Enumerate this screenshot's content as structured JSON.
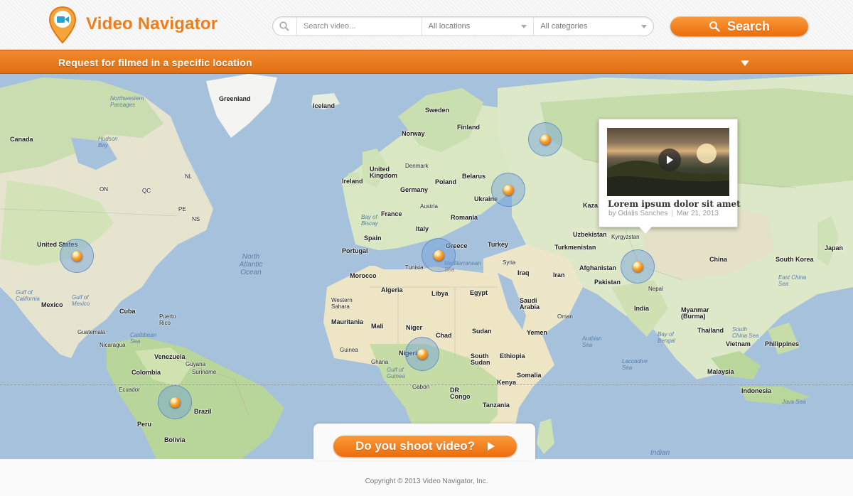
{
  "brand": {
    "name": "Video Navigator",
    "accent": "#f07d1a"
  },
  "search": {
    "placeholder": "Search video...",
    "location_value": "All locations",
    "category_value": "All categories",
    "button_label": "Search",
    "icon": "search-icon"
  },
  "request_bar": {
    "label": "Request for filmed in a specific location",
    "toggle_icon": "chevron-down-icon"
  },
  "map": {
    "labels": {
      "greenland": "Greenland",
      "iceland": "Iceland",
      "sweden": "Sweden",
      "finland": "Finland",
      "norway": "Norway",
      "denmark": "Denmark",
      "uk": "United Kingdom",
      "ireland": "Ireland",
      "belarus": "Belarus",
      "poland": "Poland",
      "germany": "Germany",
      "austria": "Austria",
      "ukraine": "Ukraine",
      "france": "France",
      "romania": "Romania",
      "bay_biscay": "Bay of Biscay",
      "spain": "Spain",
      "portugal": "Portugal",
      "italy": "Italy",
      "greece": "Greece",
      "turkey": "Turkey",
      "kaza": "Kaza",
      "uzbekistan": "Uzbekistan",
      "kyrgyzstan": "Kyrgyzstan",
      "turkmenistan": "Turkmenistan",
      "syria": "Syria",
      "iraq": "Iraq",
      "iran": "Iran",
      "afghanistan": "Afghanistan",
      "pakistan": "Pakistan",
      "nepal": "Nepal",
      "china": "China",
      "south_korea": "South Korea",
      "japan": "Japan",
      "east_china_sea": "East China Sea",
      "india": "India",
      "myanmar": "Myanmar (Burma)",
      "thailand": "Thailand",
      "vietnam": "Vietnam",
      "philippines": "Philippines",
      "bay_bengal": "Bay of Bengal",
      "malaysia": "Malaysia",
      "indonesia": "Indonesia",
      "java_sea": "Java Sea",
      "laccadive_sea": "Laccadive Sea",
      "arabian_sea": "Arabian Sea",
      "indian_ocean": "Indian",
      "saudi": "Saudi Arabia",
      "oman": "Oman",
      "yemen": "Yemen",
      "egypt": "Egypt",
      "libya": "Libya",
      "algeria": "Algeria",
      "morocco": "Morocco",
      "tunisia": "Tunisia",
      "mediterranean": "Mediterranean Sea",
      "western_sahara": "Western Sahara",
      "mauritania": "Mauritania",
      "mali": "Mali",
      "niger": "Niger",
      "chad": "Chad",
      "sudan": "Sudan",
      "south_sudan": "South Sudan",
      "ethiopia": "Ethiopia",
      "somalia": "Somalia",
      "kenya": "Kenya",
      "nigeria": "Nigeria",
      "guinea": "Guinea",
      "ghana": "Ghana",
      "gulf_guinea": "Gulf of Guinea",
      "gabon": "Gabon",
      "dr_congo": "DR Congo",
      "tanzania": "Tanzania",
      "canada": "Canada",
      "hudson_bay": "Hudson Bay",
      "northwestern_passages": "Northwestern Passages",
      "on": "ON",
      "qc": "QC",
      "nl": "NL",
      "ns": "NS",
      "pe": "PE",
      "united_states": "United States",
      "north_atlantic": "North Atlantic Ocean",
      "gulf_mexico": "Gulf of Mexico",
      "mexico": "Mexico",
      "gulf_california": "Gulf of California",
      "cuba": "Cuba",
      "puerto_rico": "Puerto Rico",
      "caribbean": "Caribbean Sea",
      "guatemala": "Guatemala",
      "nicaragua": "Nicaragua",
      "venezuela": "Venezuela",
      "guyana": "Guyana",
      "suriname": "Suriname",
      "colombia": "Colombia",
      "ecuador": "Ecuador",
      "peru": "Peru",
      "brazil": "Brazil",
      "bolivia": "Bolivia",
      "south_china_sea": "South China Sea"
    },
    "markers": [
      {
        "name": "marker-russia"
      },
      {
        "name": "marker-ukraine"
      },
      {
        "name": "marker-usa"
      },
      {
        "name": "marker-greece"
      },
      {
        "name": "marker-nepal"
      },
      {
        "name": "marker-nigeria"
      },
      {
        "name": "marker-brazil"
      }
    ]
  },
  "popup": {
    "title": "Lorem ipsum dolor sit amet",
    "author": "by Odalis Sanches",
    "date": "Mar 21, 2013"
  },
  "shoot_button": {
    "label": "Do you shoot video?"
  },
  "footer": {
    "copyright": "Copyright © 2013 Video Navigator, Inc."
  }
}
